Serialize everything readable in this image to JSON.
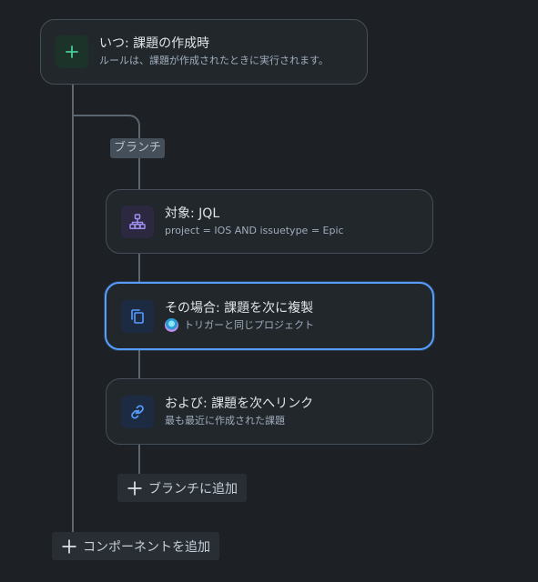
{
  "trigger": {
    "title": "いつ: 課題の作成時",
    "subtitle": "ルールは、課題が作成されたときに実行されます。",
    "icon": "plus-icon",
    "accent": "#4bce97"
  },
  "branch": {
    "label": "ブランチ",
    "condition": {
      "title": "対象: JQL",
      "subtitle": "project = IOS AND issuetype = Epic",
      "icon": "hierarchy-icon",
      "accent": "#9f8fef"
    },
    "action_clone": {
      "title": "その場合: 課題を次に複製",
      "subtitle": "トリガーと同じプロジェクト",
      "icon": "copy-icon",
      "accent": "#579dff"
    },
    "action_link": {
      "title": "および: 課題を次へリンク",
      "subtitle": "最も最近に作成された課題",
      "icon": "link-icon",
      "accent": "#579dff"
    },
    "add_button_label": "ブランチに追加"
  },
  "add_component_label": "コンポーネントを追加",
  "colors": {
    "background": "#1d2125",
    "card": "#22272b",
    "border": "#454f59",
    "selected": "#579dff"
  }
}
